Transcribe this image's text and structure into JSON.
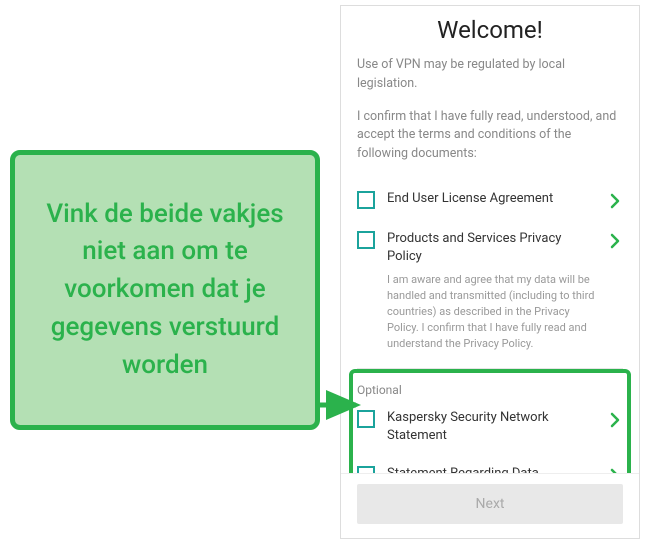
{
  "callout": {
    "text": "Vink de beide vakjes niet aan om te voorkomen dat je gegevens verstuurd worden"
  },
  "screen": {
    "title": "Welcome!",
    "intro1": "Use of VPN may be regulated by local legislation.",
    "intro2": "I confirm that I have fully read, understood, and accept the terms and conditions of the following documents:",
    "docs": [
      {
        "label": "End User License Agreement",
        "sub": ""
      },
      {
        "label": "Products and Services Privacy Policy",
        "sub": "I am aware and agree that my data will be handled and transmitted (including to third countries) as described in the Privacy Policy. I confirm that I have fully read and understand the Privacy Policy."
      }
    ],
    "optional_label": "Optional",
    "optional_docs": [
      {
        "label": "Kaspersky Security Network Statement"
      },
      {
        "label": "Statement Regarding Data Processing for Marketing Purposes"
      }
    ],
    "next_label": "Next"
  },
  "colors": {
    "accent": "#2bb24c",
    "teal": "#1ba39c"
  }
}
